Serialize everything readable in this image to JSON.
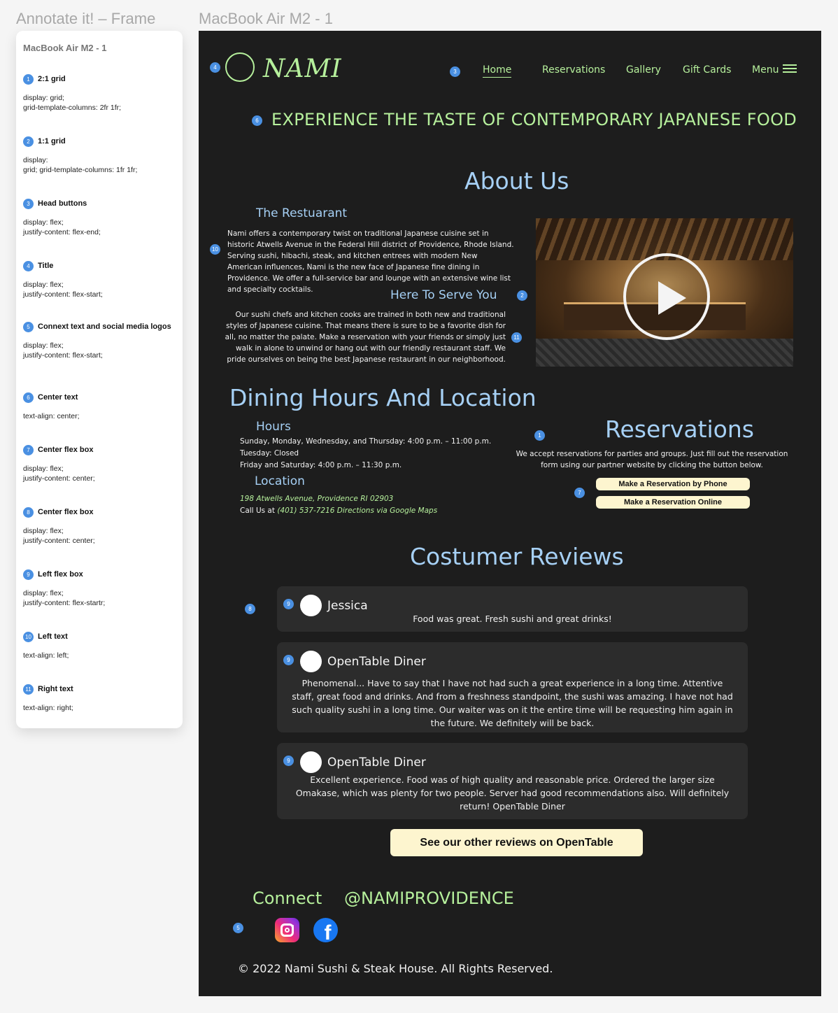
{
  "canvas": {
    "annotate_label": "Annotate it! – Frame",
    "artboard_label": "MacBook Air M2 - 1"
  },
  "panel": {
    "title": "MacBook Air M2 - 1",
    "annotations": [
      {
        "num": "1",
        "name": "2:1 grid",
        "code": "display: grid;\ngrid-template-columns: 2fr 1fr;"
      },
      {
        "num": "2",
        "name": "1:1 grid",
        "code": "display:\ngrid; grid-template-columns: 1fr 1fr;"
      },
      {
        "num": "3",
        "name": "Head buttons",
        "code": "display: flex;\njustify-content: flex-end;"
      },
      {
        "num": "4",
        "name": "Title",
        "code": "display: flex;\njustify-content: flex-start;"
      },
      {
        "num": "5",
        "name": "Connext text and social media logos",
        "code": "display: flex;\njustify-content: flex-start;"
      },
      {
        "num": "6",
        "name": "Center text",
        "code": "text-align: center;"
      },
      {
        "num": "7",
        "name": "Center flex box",
        "code": "display: flex;\njustify-content: center;"
      },
      {
        "num": "8",
        "name": "Center flex box",
        "code": "display: flex;\njustify-content: center;"
      },
      {
        "num": "9",
        "name": "Left flex box",
        "code": "display: flex;\njustify-content: flex-startr;"
      },
      {
        "num": "10",
        "name": "Left text",
        "code": "text-align: left;"
      },
      {
        "num": "11",
        "name": "Right text",
        "code": "text-align: right;"
      }
    ]
  },
  "site": {
    "logo": "NAMI",
    "nav": [
      "Home",
      "Reservations",
      "Gallery",
      "Gift Cards",
      "Menu"
    ],
    "hero": "EXPERIENCE THE TASTE OF CONTEMPORARY JAPANESE FOOD",
    "about": {
      "title": "About Us",
      "restaurant_heading": "The Restuarant",
      "restaurant_text": "Nami offers a contemporary twist on traditional Japanese cuisine set in historic Atwells Avenue in the Federal Hill district of Providence, Rhode Island. Serving sushi, hibachi, steak, and kitchen entrees with modern New American influences, Nami is the new face of Japanese fine dining in Providence. We offer a full-service bar and lounge with an extensive wine list and specialty cocktails.",
      "serve_heading": "Here To Serve You",
      "serve_text": "Our sushi chefs and kitchen cooks are trained in both new and traditional styles of Japanese cuisine. That means there is sure to be a favorite dish for all, no matter the palate. Make a reservation with your friends or simply just walk in alone to unwind or hang out with our friendly restaurant staff. We pride ourselves on being the best Japanese restaurant in our neighborhood."
    },
    "dining": {
      "title": "Dining Hours And Location",
      "hours_heading": "Hours",
      "hours": [
        "Sunday, Monday, Wednesday, and Thursday: 4:00 p.m. – 11:00 p.m.",
        "Tuesday: Closed",
        "Friday and Saturday: 4:00 p.m. – 11:30 p.m."
      ],
      "location_heading": "Location",
      "address": "198 Atwells Avenue, Providence RI 02903",
      "call_prefix": "Call Us at ",
      "call_link": "(401) 537-7216 Directions via Google Maps"
    },
    "reservations": {
      "title": "Reservations",
      "text": "We accept reservations for parties and groups. Just fill out the reservation form using our partner website by clicking the button below.",
      "btn_phone": "Make a Reservation by Phone",
      "btn_online": "Make a Reservation Online"
    },
    "reviews": {
      "title": "Costumer Reviews",
      "items": [
        {
          "name": "Jessica",
          "text": "Food was great. Fresh sushi and great drinks!"
        },
        {
          "name": "OpenTable Diner",
          "text": "Phenomenal... Have to say that I have not had such a great experience in a long time. Attentive staff, great food and drinks. And from a freshness standpoint, the sushi was amazing. I have not had such quality sushi in a long time. Our waiter was on it the entire time will be requesting him again in the future. We definitely will be back."
        },
        {
          "name": "OpenTable Diner",
          "text": "Excellent experience. Food was of high quality and reasonable price. Ordered the larger size Omakase, which was plenty for two people. Server had good recommendations also. Will definitely return! OpenTable Diner"
        }
      ],
      "cta": "See our other reviews on OpenTable"
    },
    "connect": {
      "label": "Connect",
      "handle": "@NAMIPROVIDENCE",
      "fb_glyph": "f"
    },
    "footer": "© 2022 Nami Sushi & Steak House. All Rights Reserved."
  },
  "colors": {
    "accent_green": "#b6f09c",
    "heading_blue": "#a6d0f5",
    "badge_blue": "#4a90e2",
    "background": "#1d1d1d",
    "button_cream": "#fdf5cf"
  },
  "icons": [
    "logo-circle-icon",
    "menu-hamburger-icon",
    "play-icon",
    "instagram-icon",
    "facebook-icon"
  ]
}
